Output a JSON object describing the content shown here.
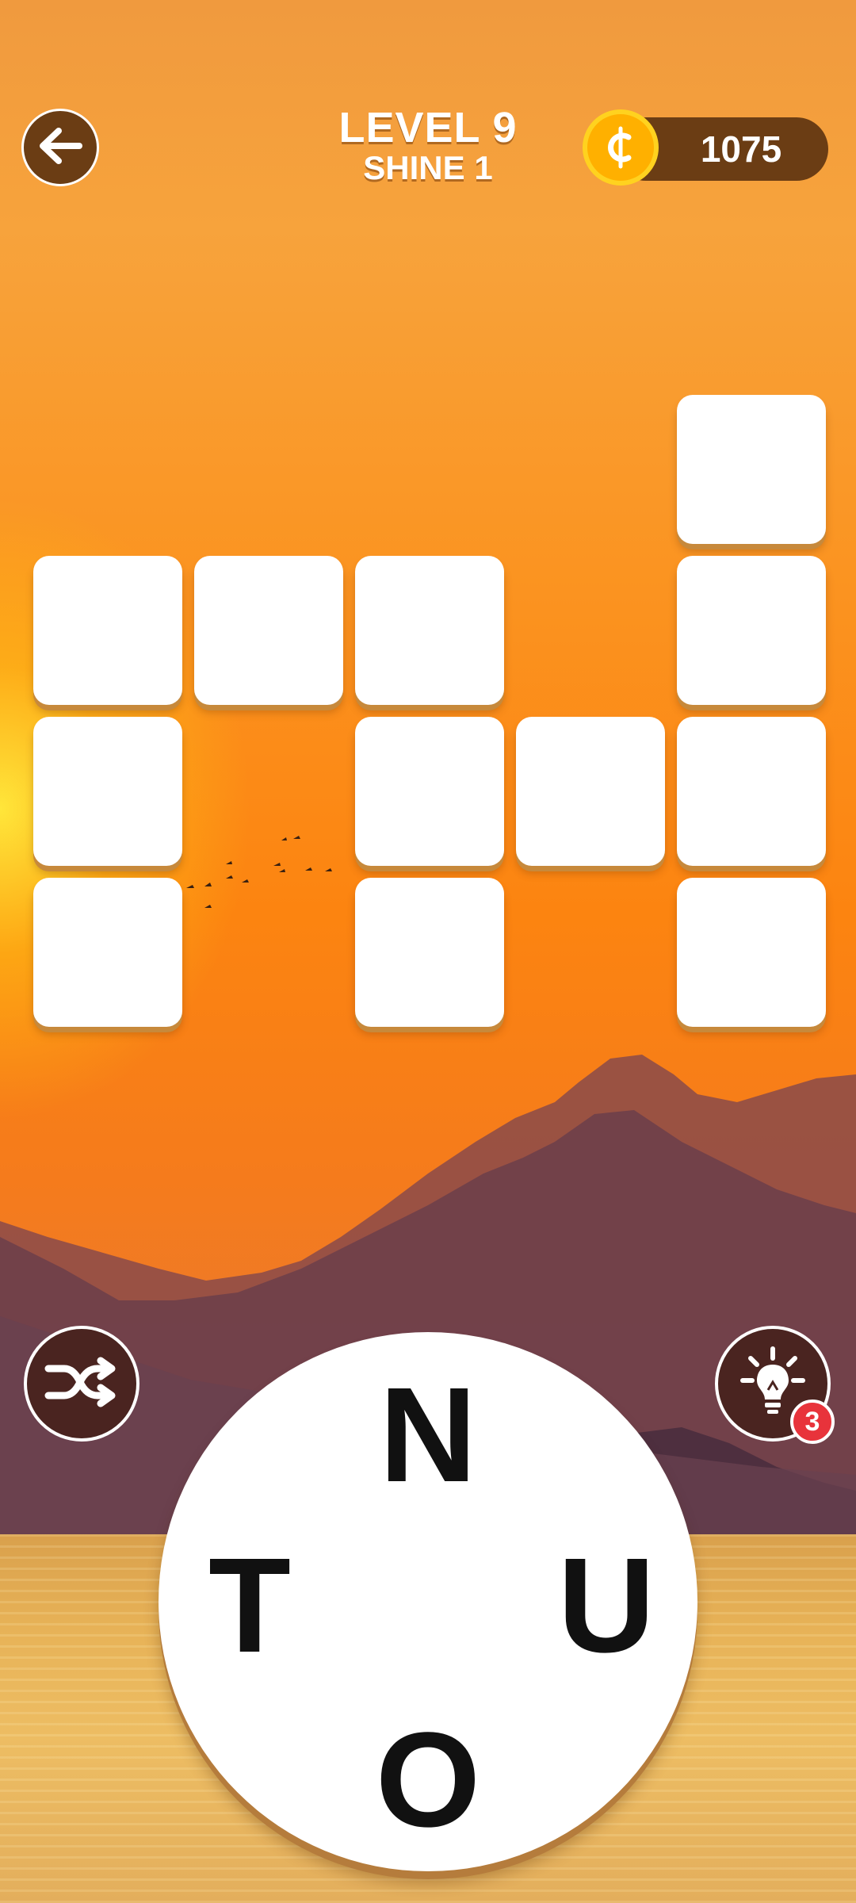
{
  "header": {
    "level_label": "LEVEL 9",
    "stage_label": "SHINE 1",
    "coins": "1075",
    "back_icon": "arrow-left-icon",
    "coin_icon": "coin-cent-icon"
  },
  "board": {
    "rows": 4,
    "cols": 5,
    "cells": [
      {
        "row": 0,
        "col": 4,
        "letter": ""
      },
      {
        "row": 1,
        "col": 0,
        "letter": ""
      },
      {
        "row": 1,
        "col": 1,
        "letter": ""
      },
      {
        "row": 1,
        "col": 2,
        "letter": ""
      },
      {
        "row": 1,
        "col": 4,
        "letter": ""
      },
      {
        "row": 2,
        "col": 0,
        "letter": ""
      },
      {
        "row": 2,
        "col": 2,
        "letter": ""
      },
      {
        "row": 2,
        "col": 3,
        "letter": ""
      },
      {
        "row": 2,
        "col": 4,
        "letter": ""
      },
      {
        "row": 3,
        "col": 0,
        "letter": ""
      },
      {
        "row": 3,
        "col": 2,
        "letter": ""
      },
      {
        "row": 3,
        "col": 4,
        "letter": ""
      }
    ]
  },
  "controls": {
    "shuffle_icon": "shuffle-icon",
    "hint_icon": "lightbulb-icon",
    "hint_count": "3"
  },
  "wheel": {
    "letters": [
      "N",
      "U",
      "O",
      "T"
    ]
  },
  "colors": {
    "button_brown": "#6b3d14",
    "coin_gold": "#ffb000",
    "badge_red": "#e8333b",
    "tile_white": "#ffffff"
  }
}
